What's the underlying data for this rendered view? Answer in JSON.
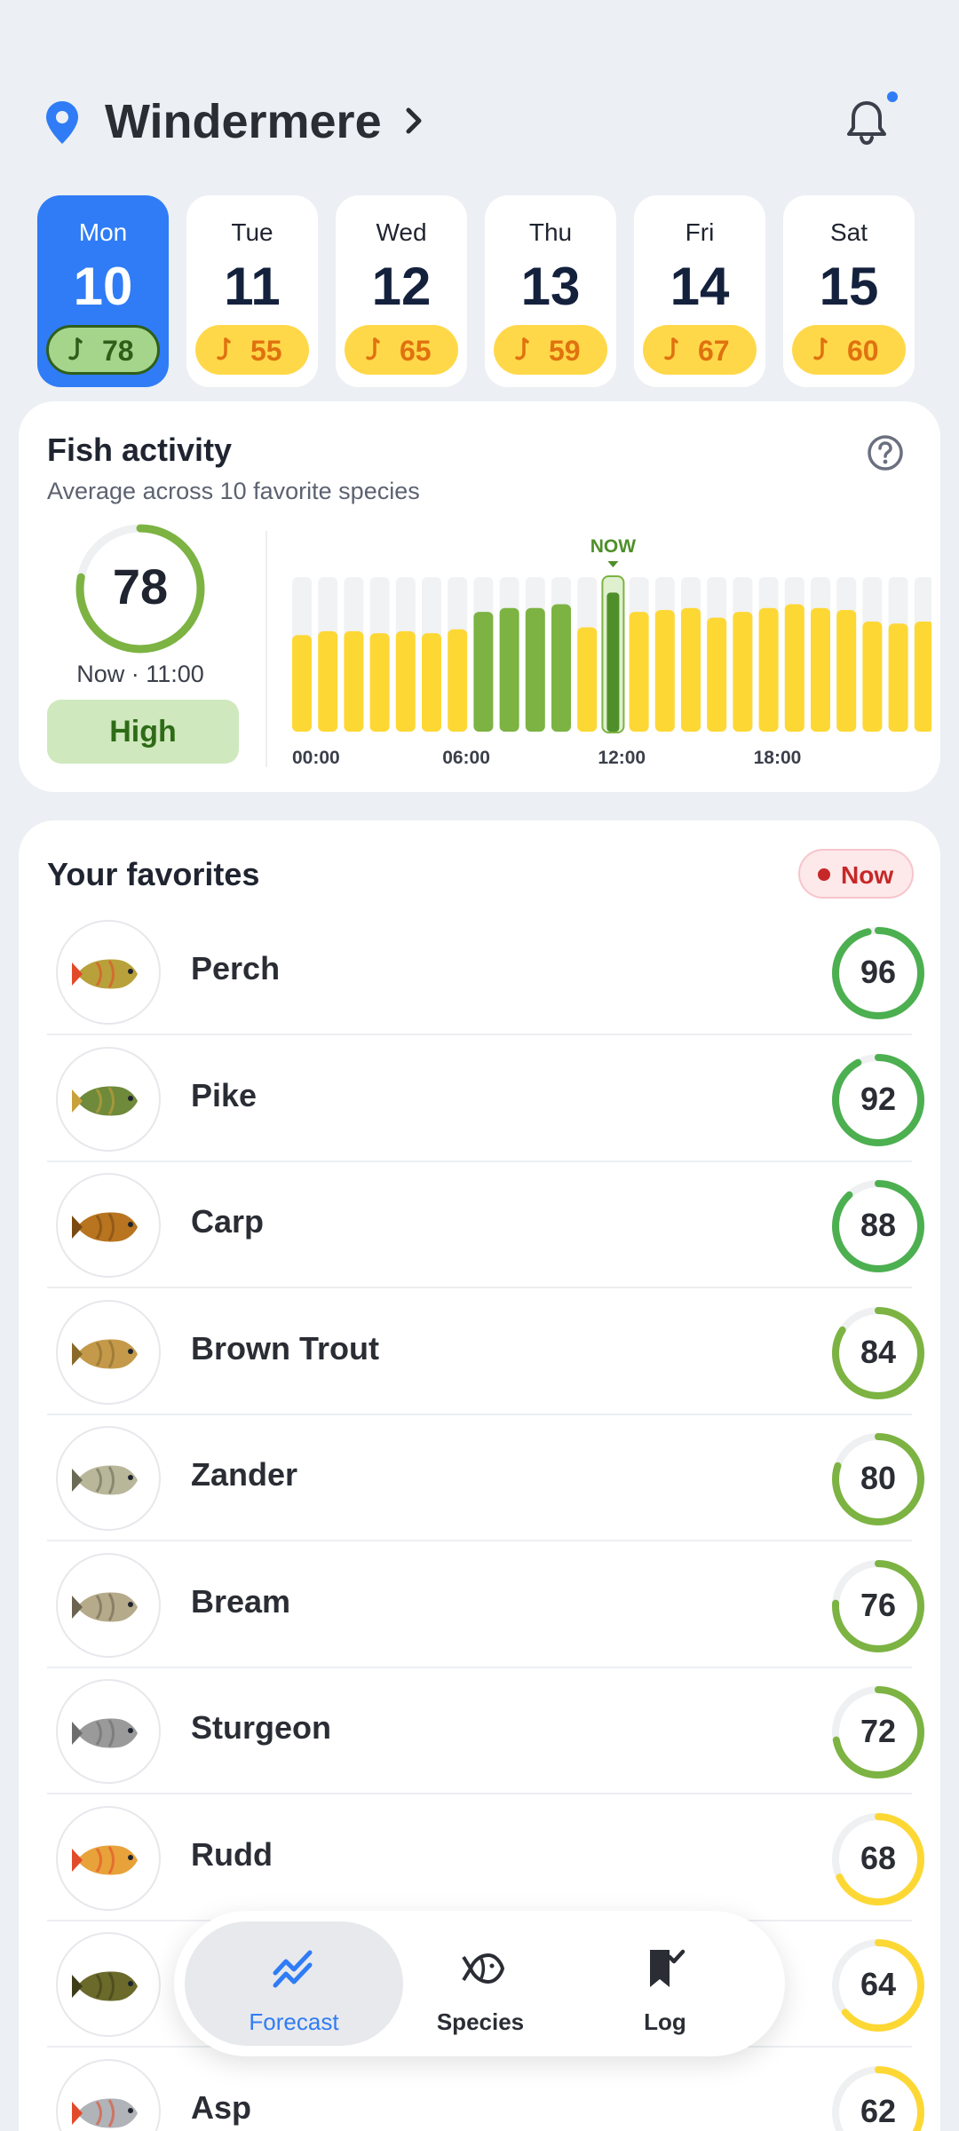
{
  "header": {
    "location": "Windermere",
    "colors": {
      "accent": "#2f7cf6"
    }
  },
  "days": [
    {
      "name": "Mon",
      "num": "10",
      "score": "78",
      "active": true
    },
    {
      "name": "Tue",
      "num": "11",
      "score": "55"
    },
    {
      "name": "Wed",
      "num": "12",
      "score": "65"
    },
    {
      "name": "Thu",
      "num": "13",
      "score": "59"
    },
    {
      "name": "Fri",
      "num": "14",
      "score": "67"
    },
    {
      "name": "Sat",
      "num": "15",
      "score": "60"
    }
  ],
  "activity": {
    "title": "Fish activity",
    "subtitle": "Average across 10 favorite species",
    "score": "78",
    "score_fraction": 0.78,
    "time": "Now · 11:00",
    "level": "High",
    "now_label": "NOW",
    "tick_labels": [
      "00:00",
      "06:00",
      "12:00",
      "18:00"
    ],
    "hourly": [
      50,
      52,
      52,
      51,
      52,
      51,
      53,
      62,
      64,
      64,
      66,
      54,
      72,
      62,
      63,
      64,
      59,
      62,
      64,
      66,
      64,
      63,
      57,
      56,
      57
    ],
    "high_hours": [
      7,
      8,
      9,
      10
    ],
    "now_index": 12
  },
  "favorites": {
    "title": "Your favorites",
    "badge": "Now",
    "items": [
      {
        "name": "Perch",
        "score": "96",
        "fraction": 0.96,
        "color": "#4caf50"
      },
      {
        "name": "Pike",
        "score": "92",
        "fraction": 0.92,
        "color": "#4caf50"
      },
      {
        "name": "Carp",
        "score": "88",
        "fraction": 0.88,
        "color": "#4caf50"
      },
      {
        "name": "Brown Trout",
        "score": "84",
        "fraction": 0.84,
        "color": "#7cb342"
      },
      {
        "name": "Zander",
        "score": "80",
        "fraction": 0.8,
        "color": "#7cb342"
      },
      {
        "name": "Bream",
        "score": "76",
        "fraction": 0.76,
        "color": "#7cb342"
      },
      {
        "name": "Sturgeon",
        "score": "72",
        "fraction": 0.72,
        "color": "#7cb342"
      },
      {
        "name": "Rudd",
        "score": "68",
        "fraction": 0.68,
        "color": "#fdd835"
      },
      {
        "name": "",
        "score": "64",
        "fraction": 0.64,
        "color": "#fdd835"
      },
      {
        "name": "Asp",
        "score": "62",
        "fraction": 0.62,
        "color": "#fdd835"
      }
    ]
  },
  "nav": {
    "forecast": "Forecast",
    "species": "Species",
    "log": "Log"
  }
}
